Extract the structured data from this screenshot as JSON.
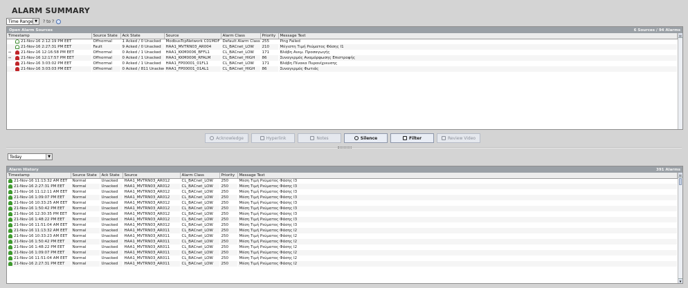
{
  "page": {
    "title": "ALARM SUMMARY"
  },
  "time_range": {
    "selected": "Time Range",
    "range_text": "? to ?"
  },
  "summary_panel": {
    "title": "Open Alarm Sources",
    "count": "6 Sources / 94 Alarms",
    "columns": [
      "Timestamp",
      "Source State",
      "Ack State",
      "Source",
      "Alarm Class",
      "Priority",
      "Message Text"
    ],
    "rows": [
      {
        "link": "",
        "icon": "outline",
        "timestamp": "21-Nov-16 2:12:19 PM EET",
        "source_state": "Offnormal",
        "ack_state": "1 Acked / 0 Unacked",
        "source": "ModbusTcpNetwork C01MDF",
        "alarm_class": "Default Alarm Class",
        "priority": "255",
        "message": "Ping Failed"
      },
      {
        "link": "",
        "icon": "outline",
        "timestamp": "21-Nov-16 2:27:31 PM EET",
        "source_state": "Fault",
        "ack_state": "9 Acked / 0 Unacked",
        "source": "HAA1_MVTRN03_AR004",
        "alarm_class": "CL_BACnet_LOW",
        "priority": "210",
        "message": "Μέγιστη Τιμή Ρεύματος Φάσης I1"
      },
      {
        "link": "⇔",
        "icon": "red",
        "timestamp": "21-Nov-16 12:16:58 PM EET",
        "source_state": "Offnormal",
        "ack_state": "0 Acked / 1 Unacked",
        "source": "HAA1_KKM0006_BFFL1",
        "alarm_class": "CL_BACnet_LOW",
        "priority": "171",
        "message": "Βλάβη Ανεμ. Προσαγωγής"
      },
      {
        "link": "⇔",
        "icon": "red",
        "timestamp": "21-Nov-16 12:17:57 PM EET",
        "source_state": "Offnormal",
        "ack_state": "0 Acked / 1 Unacked",
        "source": "HAA1_KKM0006_RFALM",
        "alarm_class": "CL_BACnet_HIGH",
        "priority": "86",
        "message": "Συναγερμός Αναμόρφωσης Επιστροφής"
      },
      {
        "link": "",
        "icon": "red",
        "timestamp": "21-Nov-16 3:03:02 PM EET",
        "source_state": "Offnormal",
        "ack_state": "0 Acked / 1 Unacked",
        "source": "HAA1_FP00001_01FL1",
        "alarm_class": "CL_BACnet_LOW",
        "priority": "171",
        "message": "Βλάβη Πίνακα Πυρανίχνευσης"
      },
      {
        "link": "",
        "icon": "red",
        "timestamp": "21-Nov-16 3:03:03 PM EET",
        "source_state": "Offnormal",
        "ack_state": "0 Acked / 811 Unacked",
        "source": "HAA1_FP00001_01AL1",
        "alarm_class": "CL_BACnet_HIGH",
        "priority": "86",
        "message": "Συναγερμός Φωτιάς"
      }
    ]
  },
  "actions": {
    "acknowledge": "Acknowledge",
    "hyperlink": "Hyperlink",
    "notes": "Notes",
    "silence": "Silence",
    "filter": "Filter",
    "review_video": "Review Video"
  },
  "history_filter": {
    "selected": "Today"
  },
  "history_panel": {
    "title": "Alarm History",
    "count": "391 Alarms",
    "columns": [
      "Timestamp",
      "Source State",
      "Ack State",
      "Source",
      "Alarm Class",
      "Priority",
      "Message Text"
    ],
    "rows": [
      {
        "timestamp": "21-Nov-16 11:13:32 AM EET",
        "source_state": "Normal",
        "ack_state": "Unacked",
        "source": "HAA1_MVTRN03_AR012",
        "alarm_class": "CL_BACnet_LOW",
        "priority": "250",
        "message": "Μέση Τιμή Ρεύματος Φάσης I3"
      },
      {
        "timestamp": "21-Nov-16 2:27:31 PM EET",
        "source_state": "Normal",
        "ack_state": "Unacked",
        "source": "HAA1_MVTRN03_AR012",
        "alarm_class": "CL_BACnet_LOW",
        "priority": "250",
        "message": "Μέση Τιμή Ρεύματος Φάσης I3"
      },
      {
        "timestamp": "21-Nov-16 11:12:11 AM EET",
        "source_state": "Normal",
        "ack_state": "Unacked",
        "source": "HAA1_MVTRN03_AR012",
        "alarm_class": "CL_BACnet_LOW",
        "priority": "250",
        "message": "Μέση Τιμή Ρεύματος Φάσης I3"
      },
      {
        "timestamp": "21-Nov-16 1:09:07 PM EET",
        "source_state": "Normal",
        "ack_state": "Unacked",
        "source": "HAA1_MVTRN03_AR012",
        "alarm_class": "CL_BACnet_LOW",
        "priority": "250",
        "message": "Μέση Τιμή Ρεύματος Φάσης I3"
      },
      {
        "timestamp": "21-Nov-16 10:33:25 AM EET",
        "source_state": "Normal",
        "ack_state": "Unacked",
        "source": "HAA1_MVTRN03_AR012",
        "alarm_class": "CL_BACnet_LOW",
        "priority": "250",
        "message": "Μέση Τιμή Ρεύματος Φάσης I3"
      },
      {
        "timestamp": "21-Nov-16 1:50:42 PM EET",
        "source_state": "Normal",
        "ack_state": "Unacked",
        "source": "HAA1_MVTRN03_AR012",
        "alarm_class": "CL_BACnet_LOW",
        "priority": "250",
        "message": "Μέση Τιμή Ρεύματος Φάσης I3"
      },
      {
        "timestamp": "21-Nov-16 12:30:35 PM EET",
        "source_state": "Normal",
        "ack_state": "Unacked",
        "source": "HAA1_MVTRN03_AR012",
        "alarm_class": "CL_BACnet_LOW",
        "priority": "250",
        "message": "Μέση Τιμή Ρεύματος Φάσης I3"
      },
      {
        "timestamp": "21-Nov-16 1:48:22 PM EET",
        "source_state": "Normal",
        "ack_state": "Unacked",
        "source": "HAA1_MVTRN03_AR012",
        "alarm_class": "CL_BACnet_LOW",
        "priority": "250",
        "message": "Μέση Τιμή Ρεύματος Φάσης I3"
      },
      {
        "timestamp": "21-Nov-16 11:51:04 AM EET",
        "source_state": "Normal",
        "ack_state": "Unacked",
        "source": "HAA1_MVTRN03_AR012",
        "alarm_class": "CL_BACnet_LOW",
        "priority": "250",
        "message": "Μέση Τιμή Ρεύματος Φάσης I3"
      },
      {
        "timestamp": "21-Nov-16 11:13:32 AM EET",
        "source_state": "Normal",
        "ack_state": "Unacked",
        "source": "HAA1_MVTRN03_AR011",
        "alarm_class": "CL_BACnet_LOW",
        "priority": "250",
        "message": "Μέση Τιμή Ρεύματος Φάσης I2"
      },
      {
        "timestamp": "21-Nov-16 10:33:23 AM EET",
        "source_state": "Normal",
        "ack_state": "Unacked",
        "source": "HAA1_MVTRN03_AR011",
        "alarm_class": "CL_BACnet_LOW",
        "priority": "250",
        "message": "Μέση Τιμή Ρεύματος Φάσης I2"
      },
      {
        "timestamp": "21-Nov-16 1:50:42 PM EET",
        "source_state": "Normal",
        "ack_state": "Unacked",
        "source": "HAA1_MVTRN03_AR011",
        "alarm_class": "CL_BACnet_LOW",
        "priority": "250",
        "message": "Μέση Τιμή Ρεύματος Φάσης I2"
      },
      {
        "timestamp": "21-Nov-16 1:48:22 PM EET",
        "source_state": "Normal",
        "ack_state": "Unacked",
        "source": "HAA1_MVTRN03_AR011",
        "alarm_class": "CL_BACnet_LOW",
        "priority": "250",
        "message": "Μέση Τιμή Ρεύματος Φάσης I2"
      },
      {
        "timestamp": "21-Nov-16 1:09:07 PM EET",
        "source_state": "Normal",
        "ack_state": "Unacked",
        "source": "HAA1_MVTRN03_AR011",
        "alarm_class": "CL_BACnet_LOW",
        "priority": "250",
        "message": "Μέση Τιμή Ρεύματος Φάσης I2"
      },
      {
        "timestamp": "21-Nov-16 11:51:04 AM EET",
        "source_state": "Normal",
        "ack_state": "Unacked",
        "source": "HAA1_MVTRN03_AR011",
        "alarm_class": "CL_BACnet_LOW",
        "priority": "250",
        "message": "Μέση Τιμή Ρεύματος Φάσης I2"
      },
      {
        "timestamp": "21-Nov-16 2:27:31 PM EET",
        "source_state": "Normal",
        "ack_state": "Unacked",
        "source": "HAA1_MVTRN03_AR011",
        "alarm_class": "CL_BACnet_LOW",
        "priority": "250",
        "message": "Μέση Τιμή Ρεύματος Φάσης I2"
      }
    ]
  }
}
